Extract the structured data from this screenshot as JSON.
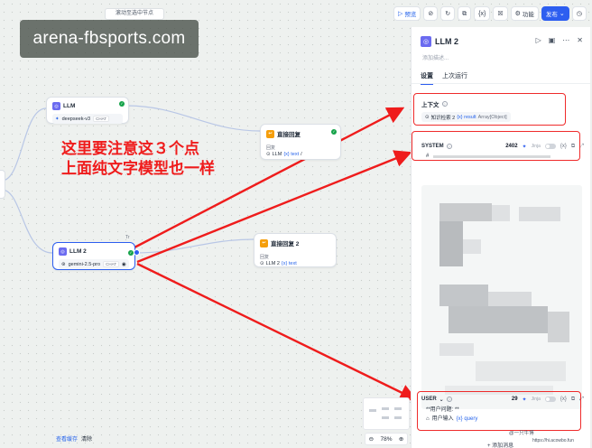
{
  "watermark": "arena-fbsports.com",
  "canvas": {
    "scroll_hint": "滚动至选中节点",
    "annotation_lines": [
      "这里要注意这３个点",
      "上面纯文字模型也一样"
    ],
    "bottom_links": {
      "view_cache": "查看缓存",
      "clear": "清除"
    },
    "zoom": "78%",
    "credit_line1": "@一只牛博",
    "credit_line2": "https://hi.acowbo.fun"
  },
  "toolbar": {
    "preview": "预览",
    "features": "功能",
    "publish": "发布"
  },
  "nodes": {
    "llm1": {
      "title": "LLM",
      "model": "deepseek-v3",
      "badge": "CHAT"
    },
    "reply1": {
      "title": "直接回复",
      "label": "回复",
      "ref_node": "LLM",
      "ref_var": "{x} text",
      "ref_tail": "/"
    },
    "llm2": {
      "title": "LLM 2",
      "model": "gemini-2.5-pro",
      "badge": "CHAT",
      "tag": "Tr"
    },
    "reply2": {
      "title": "直接回复 2",
      "label": "回复",
      "ref_node": "LLM 2",
      "ref_var": "{x} text"
    }
  },
  "panel": {
    "title": "LLM 2",
    "description_placeholder": "添加描述...",
    "tabs": [
      {
        "label": "设置",
        "active": true
      },
      {
        "label": "上次运行",
        "active": false
      }
    ],
    "context": {
      "label": "上下文",
      "chip_node": "知识检索 2",
      "chip_var": "{x} result",
      "chip_type": "Array[Object]"
    },
    "system": {
      "role": "SYSTEM",
      "count": "2402",
      "jinja": "Jinja",
      "first_line": "# "
    },
    "user": {
      "role": "USER",
      "count": "29",
      "jinja": "Jinja",
      "line1": "**用户问题: **",
      "line2_node": "用户输入",
      "line2_var": "{x} query"
    },
    "add_message": "+ 添加消息"
  },
  "colors": {
    "accent": "#2d5ef0",
    "annotation_red": "#ef1c1c",
    "success": "#16a34a",
    "llm_icon": "#6b6bf0",
    "reply_icon": "#f59e0b"
  }
}
